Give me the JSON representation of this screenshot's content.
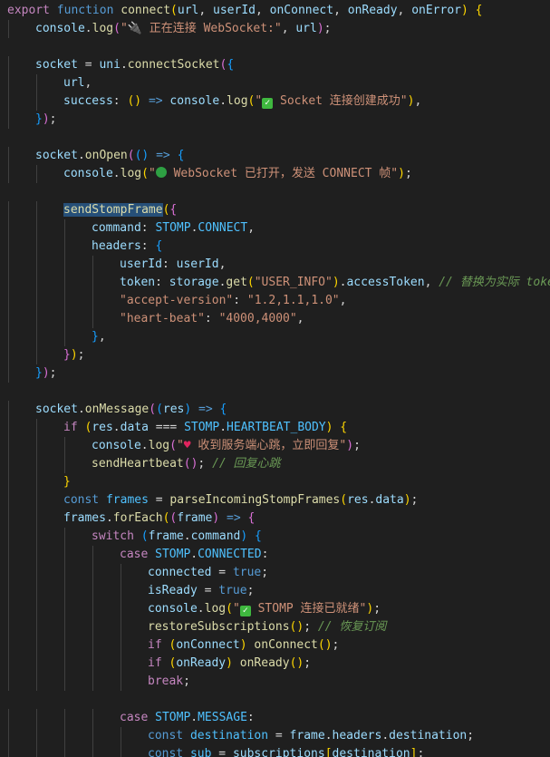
{
  "editor": {
    "lines": [
      {
        "indent": 0,
        "tokens": [
          [
            "kw",
            "export"
          ],
          [
            "pl",
            " "
          ],
          [
            "st",
            "function"
          ],
          [
            "pl",
            " "
          ],
          [
            "fn",
            "connect"
          ],
          [
            "br1",
            "("
          ],
          [
            "var",
            "url"
          ],
          [
            "pl",
            ", "
          ],
          [
            "var",
            "userId"
          ],
          [
            "pl",
            ", "
          ],
          [
            "var",
            "onConnect"
          ],
          [
            "pl",
            ", "
          ],
          [
            "var",
            "onReady"
          ],
          [
            "pl",
            ", "
          ],
          [
            "var",
            "onError"
          ],
          [
            "br1",
            ")"
          ],
          [
            "pl",
            " "
          ],
          [
            "br1",
            "{"
          ]
        ]
      },
      {
        "indent": 1,
        "tokens": [
          [
            "var",
            "console"
          ],
          [
            "pl",
            "."
          ],
          [
            "fn",
            "log"
          ],
          [
            "br2",
            "("
          ],
          [
            "str",
            "\""
          ],
          [
            "icon",
            "plug"
          ],
          [
            "str",
            " 正在连接 WebSocket:\""
          ],
          [
            "pl",
            ", "
          ],
          [
            "var",
            "url"
          ],
          [
            "br2",
            ")"
          ],
          [
            "pl",
            ";"
          ]
        ]
      },
      {
        "indent": 0,
        "tokens": []
      },
      {
        "indent": 1,
        "tokens": [
          [
            "var",
            "socket"
          ],
          [
            "pl",
            " = "
          ],
          [
            "var",
            "uni"
          ],
          [
            "pl",
            "."
          ],
          [
            "fn",
            "connectSocket"
          ],
          [
            "br2",
            "("
          ],
          [
            "br3",
            "{"
          ]
        ]
      },
      {
        "indent": 2,
        "tokens": [
          [
            "var",
            "url"
          ],
          [
            "pl",
            ","
          ]
        ]
      },
      {
        "indent": 2,
        "tokens": [
          [
            "var",
            "success"
          ],
          [
            "pl",
            ": "
          ],
          [
            "br1",
            "()"
          ],
          [
            "pl",
            " "
          ],
          [
            "st",
            "=>"
          ],
          [
            "pl",
            " "
          ],
          [
            "var",
            "console"
          ],
          [
            "pl",
            "."
          ],
          [
            "fn",
            "log"
          ],
          [
            "br1",
            "("
          ],
          [
            "str",
            "\""
          ],
          [
            "icon",
            "check"
          ],
          [
            "str",
            " Socket 连接创建成功\""
          ],
          [
            "br1",
            ")"
          ],
          [
            "pl",
            ","
          ]
        ]
      },
      {
        "indent": 1,
        "tokens": [
          [
            "br3",
            "}"
          ],
          [
            "br2",
            ")"
          ],
          [
            "pl",
            ";"
          ]
        ]
      },
      {
        "indent": 0,
        "tokens": []
      },
      {
        "indent": 1,
        "tokens": [
          [
            "var",
            "socket"
          ],
          [
            "pl",
            "."
          ],
          [
            "fn",
            "onOpen"
          ],
          [
            "br2",
            "("
          ],
          [
            "br3",
            "()"
          ],
          [
            "pl",
            " "
          ],
          [
            "st",
            "=>"
          ],
          [
            "pl",
            " "
          ],
          [
            "br3",
            "{"
          ]
        ]
      },
      {
        "indent": 2,
        "tokens": [
          [
            "var",
            "console"
          ],
          [
            "pl",
            "."
          ],
          [
            "fn",
            "log"
          ],
          [
            "br1",
            "("
          ],
          [
            "str",
            "\""
          ],
          [
            "icon",
            "circle"
          ],
          [
            "str",
            " WebSocket 已打开，发送 CONNECT 帧\""
          ],
          [
            "br1",
            ")"
          ],
          [
            "pl",
            ";"
          ]
        ]
      },
      {
        "indent": 0,
        "tokens": []
      },
      {
        "indent": 2,
        "tokens": [
          [
            "fnhl",
            "sendStompFrame"
          ],
          [
            "br1",
            "("
          ],
          [
            "br2",
            "{"
          ]
        ]
      },
      {
        "indent": 3,
        "tokens": [
          [
            "var",
            "command"
          ],
          [
            "pl",
            ": "
          ],
          [
            "con",
            "STOMP"
          ],
          [
            "pl",
            "."
          ],
          [
            "con",
            "CONNECT"
          ],
          [
            "pl",
            ","
          ]
        ]
      },
      {
        "indent": 3,
        "tokens": [
          [
            "var",
            "headers"
          ],
          [
            "pl",
            ": "
          ],
          [
            "br3",
            "{"
          ]
        ]
      },
      {
        "indent": 4,
        "tokens": [
          [
            "var",
            "userId"
          ],
          [
            "pl",
            ": "
          ],
          [
            "var",
            "userId"
          ],
          [
            "pl",
            ","
          ]
        ]
      },
      {
        "indent": 4,
        "tokens": [
          [
            "var",
            "token"
          ],
          [
            "pl",
            ": "
          ],
          [
            "var",
            "storage"
          ],
          [
            "pl",
            "."
          ],
          [
            "fn",
            "get"
          ],
          [
            "br1",
            "("
          ],
          [
            "str",
            "\"USER_INFO\""
          ],
          [
            "br1",
            ")"
          ],
          [
            "pl",
            "."
          ],
          [
            "var",
            "accessToken"
          ],
          [
            "pl",
            ", "
          ],
          [
            "cm",
            "// 替换为实际 token"
          ]
        ]
      },
      {
        "indent": 4,
        "tokens": [
          [
            "str",
            "\"accept-version\""
          ],
          [
            "pl",
            ": "
          ],
          [
            "str",
            "\"1.2,1.1,1.0\""
          ],
          [
            "pl",
            ","
          ]
        ]
      },
      {
        "indent": 4,
        "tokens": [
          [
            "str",
            "\"heart-beat\""
          ],
          [
            "pl",
            ": "
          ],
          [
            "str",
            "\"4000,4000\""
          ],
          [
            "pl",
            ","
          ]
        ]
      },
      {
        "indent": 3,
        "tokens": [
          [
            "br3",
            "}"
          ],
          [
            "pl",
            ","
          ]
        ]
      },
      {
        "indent": 2,
        "tokens": [
          [
            "br2",
            "}"
          ],
          [
            "br1",
            ")"
          ],
          [
            "pl",
            ";"
          ]
        ]
      },
      {
        "indent": 1,
        "tokens": [
          [
            "br3",
            "}"
          ],
          [
            "br2",
            ")"
          ],
          [
            "pl",
            ";"
          ]
        ]
      },
      {
        "indent": 0,
        "tokens": []
      },
      {
        "indent": 1,
        "tokens": [
          [
            "var",
            "socket"
          ],
          [
            "pl",
            "."
          ],
          [
            "fn",
            "onMessage"
          ],
          [
            "br2",
            "("
          ],
          [
            "br3",
            "("
          ],
          [
            "var",
            "res"
          ],
          [
            "br3",
            ")"
          ],
          [
            "pl",
            " "
          ],
          [
            "st",
            "=>"
          ],
          [
            "pl",
            " "
          ],
          [
            "br3",
            "{"
          ]
        ]
      },
      {
        "indent": 2,
        "tokens": [
          [
            "kw",
            "if"
          ],
          [
            "pl",
            " "
          ],
          [
            "br1",
            "("
          ],
          [
            "var",
            "res"
          ],
          [
            "pl",
            "."
          ],
          [
            "var",
            "data"
          ],
          [
            "pl",
            " === "
          ],
          [
            "con",
            "STOMP"
          ],
          [
            "pl",
            "."
          ],
          [
            "con",
            "HEARTBEAT_BODY"
          ],
          [
            "br1",
            ")"
          ],
          [
            "pl",
            " "
          ],
          [
            "br1",
            "{"
          ]
        ]
      },
      {
        "indent": 3,
        "tokens": [
          [
            "var",
            "console"
          ],
          [
            "pl",
            "."
          ],
          [
            "fn",
            "log"
          ],
          [
            "br2",
            "("
          ],
          [
            "str",
            "\""
          ],
          [
            "icon",
            "heart"
          ],
          [
            "str",
            " 收到服务端心跳，立即回复\""
          ],
          [
            "br2",
            ")"
          ],
          [
            "pl",
            ";"
          ]
        ]
      },
      {
        "indent": 3,
        "tokens": [
          [
            "fn",
            "sendHeartbeat"
          ],
          [
            "br2",
            "()"
          ],
          [
            "pl",
            "; "
          ],
          [
            "cm",
            "// 回复心跳"
          ]
        ]
      },
      {
        "indent": 2,
        "tokens": [
          [
            "br1",
            "}"
          ]
        ]
      },
      {
        "indent": 2,
        "tokens": [
          [
            "st",
            "const"
          ],
          [
            "pl",
            " "
          ],
          [
            "con",
            "frames"
          ],
          [
            "pl",
            " = "
          ],
          [
            "fn",
            "parseIncomingStompFrames"
          ],
          [
            "br1",
            "("
          ],
          [
            "var",
            "res"
          ],
          [
            "pl",
            "."
          ],
          [
            "var",
            "data"
          ],
          [
            "br1",
            ")"
          ],
          [
            "pl",
            ";"
          ]
        ]
      },
      {
        "indent": 2,
        "tokens": [
          [
            "var",
            "frames"
          ],
          [
            "pl",
            "."
          ],
          [
            "fn",
            "forEach"
          ],
          [
            "br1",
            "("
          ],
          [
            "br2",
            "("
          ],
          [
            "var",
            "frame"
          ],
          [
            "br2",
            ")"
          ],
          [
            "pl",
            " "
          ],
          [
            "st",
            "=>"
          ],
          [
            "pl",
            " "
          ],
          [
            "br2",
            "{"
          ]
        ]
      },
      {
        "indent": 3,
        "tokens": [
          [
            "kw",
            "switch"
          ],
          [
            "pl",
            " "
          ],
          [
            "br3",
            "("
          ],
          [
            "var",
            "frame"
          ],
          [
            "pl",
            "."
          ],
          [
            "var",
            "command"
          ],
          [
            "br3",
            ")"
          ],
          [
            "pl",
            " "
          ],
          [
            "br3",
            "{"
          ]
        ]
      },
      {
        "indent": 4,
        "tokens": [
          [
            "kw",
            "case"
          ],
          [
            "pl",
            " "
          ],
          [
            "con",
            "STOMP"
          ],
          [
            "pl",
            "."
          ],
          [
            "con",
            "CONNECTED"
          ],
          [
            "pl",
            ":"
          ]
        ]
      },
      {
        "indent": 5,
        "tokens": [
          [
            "var",
            "connected"
          ],
          [
            "pl",
            " = "
          ],
          [
            "st",
            "true"
          ],
          [
            "pl",
            ";"
          ]
        ]
      },
      {
        "indent": 5,
        "tokens": [
          [
            "var",
            "isReady"
          ],
          [
            "pl",
            " = "
          ],
          [
            "st",
            "true"
          ],
          [
            "pl",
            ";"
          ]
        ]
      },
      {
        "indent": 5,
        "tokens": [
          [
            "var",
            "console"
          ],
          [
            "pl",
            "."
          ],
          [
            "fn",
            "log"
          ],
          [
            "br1",
            "("
          ],
          [
            "str",
            "\""
          ],
          [
            "icon",
            "check"
          ],
          [
            "str",
            " STOMP 连接已就绪\""
          ],
          [
            "br1",
            ")"
          ],
          [
            "pl",
            ";"
          ]
        ]
      },
      {
        "indent": 5,
        "tokens": [
          [
            "fn",
            "restoreSubscriptions"
          ],
          [
            "br1",
            "()"
          ],
          [
            "pl",
            "; "
          ],
          [
            "cm",
            "// 恢复订阅"
          ]
        ]
      },
      {
        "indent": 5,
        "tokens": [
          [
            "kw",
            "if"
          ],
          [
            "pl",
            " "
          ],
          [
            "br1",
            "("
          ],
          [
            "var",
            "onConnect"
          ],
          [
            "br1",
            ")"
          ],
          [
            "pl",
            " "
          ],
          [
            "fn",
            "onConnect"
          ],
          [
            "br1",
            "()"
          ],
          [
            "pl",
            ";"
          ]
        ]
      },
      {
        "indent": 5,
        "tokens": [
          [
            "kw",
            "if"
          ],
          [
            "pl",
            " "
          ],
          [
            "br1",
            "("
          ],
          [
            "var",
            "onReady"
          ],
          [
            "br1",
            ")"
          ],
          [
            "pl",
            " "
          ],
          [
            "fn",
            "onReady"
          ],
          [
            "br1",
            "()"
          ],
          [
            "pl",
            ";"
          ]
        ]
      },
      {
        "indent": 5,
        "tokens": [
          [
            "kw",
            "break"
          ],
          [
            "pl",
            ";"
          ]
        ]
      },
      {
        "indent": 0,
        "tokens": []
      },
      {
        "indent": 4,
        "tokens": [
          [
            "kw",
            "case"
          ],
          [
            "pl",
            " "
          ],
          [
            "con",
            "STOMP"
          ],
          [
            "pl",
            "."
          ],
          [
            "con",
            "MESSAGE"
          ],
          [
            "pl",
            ":"
          ]
        ]
      },
      {
        "indent": 5,
        "tokens": [
          [
            "st",
            "const"
          ],
          [
            "pl",
            " "
          ],
          [
            "con",
            "destination"
          ],
          [
            "pl",
            " = "
          ],
          [
            "var",
            "frame"
          ],
          [
            "pl",
            "."
          ],
          [
            "var",
            "headers"
          ],
          [
            "pl",
            "."
          ],
          [
            "var",
            "destination"
          ],
          [
            "pl",
            ";"
          ]
        ]
      },
      {
        "indent": 5,
        "tokens": [
          [
            "st",
            "const"
          ],
          [
            "pl",
            " "
          ],
          [
            "con",
            "sub"
          ],
          [
            "pl",
            " = "
          ],
          [
            "var",
            "subscriptions"
          ],
          [
            "br1",
            "["
          ],
          [
            "var",
            "destination"
          ],
          [
            "br1",
            "]"
          ],
          [
            "pl",
            ";"
          ]
        ]
      }
    ],
    "guide_colors": [
      "#404040",
      "#404040",
      "#404040",
      "#404040",
      "#404040"
    ]
  }
}
